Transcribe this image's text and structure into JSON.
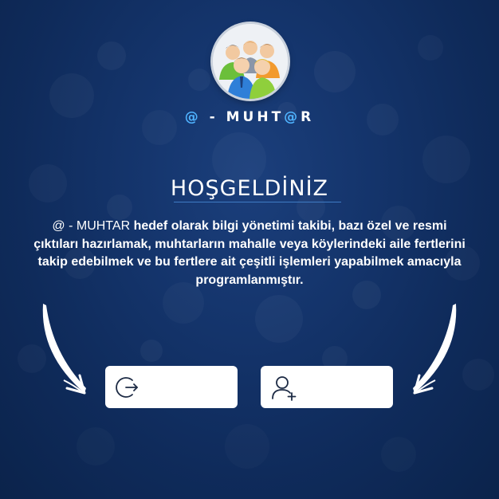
{
  "app": {
    "brand_prefix": "@",
    "brand_middle": " - MUHT",
    "brand_at": "@",
    "brand_suffix": "R",
    "logo_icon": "people-group-icon"
  },
  "welcome": {
    "title": "HOŞGELDİNİZ"
  },
  "description": {
    "brand_name": "@ - MUHTAR",
    "text": " hedef olarak bilgi yönetimi takibi, bazı özel ve resmi çıktıları hazırlamak, muhtarların mahalle veya köylerindeki aile fertlerini takip edebilmek ve bu fertlere ait çeşitli işlemleri yapabilmek amacıyla programlanmıştır."
  },
  "actions": {
    "login": {
      "icon": "login-icon"
    },
    "register": {
      "icon": "add-user-icon"
    }
  },
  "colors": {
    "background": "#14346b",
    "accent": "#4fb3ff",
    "button_bg": "#ffffff",
    "icon": "#1c2a44"
  }
}
